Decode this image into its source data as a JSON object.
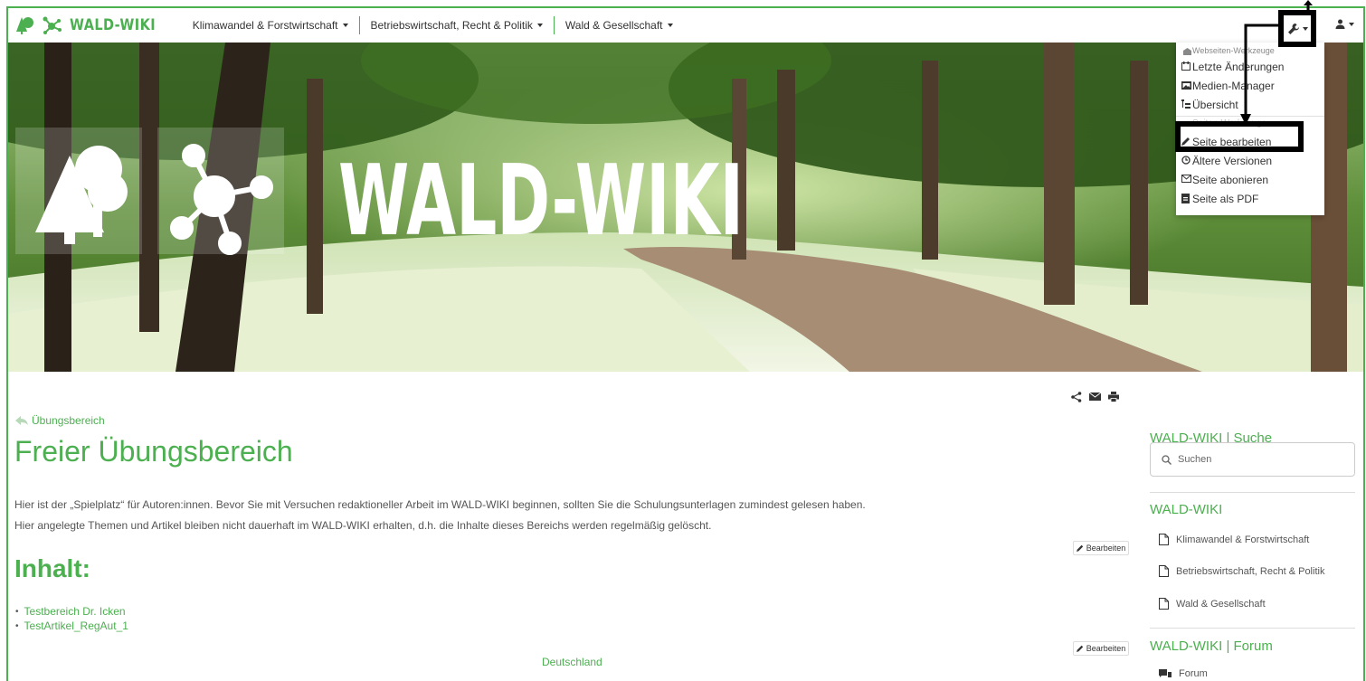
{
  "brand": {
    "name": "WALD-WIKI",
    "color": "#4caf50"
  },
  "nav": {
    "items": [
      {
        "label": "Klimawandel & Forstwirtschaft"
      },
      {
        "label": "Betriebswirtschaft, Recht & Politik"
      },
      {
        "label": "Wald & Gesellschaft"
      }
    ]
  },
  "toolbar": {
    "tools_icon": "wrench-icon",
    "user_icon": "user-icon"
  },
  "hero": {
    "title": "WALD-WIKI"
  },
  "tools_menu": {
    "header": "Webseiten-Werkzeuge",
    "site_items": [
      {
        "label": "Letzte Änderungen",
        "icon": "recent-changes-icon"
      },
      {
        "label": "Medien-Manager",
        "icon": "media-manager-icon"
      },
      {
        "label": "Übersicht",
        "icon": "sitemap-icon"
      }
    ],
    "page_header": "Seiten-Werkzeuge",
    "page_items": [
      {
        "label": "Seite bearbeiten",
        "icon": "pencil-icon"
      },
      {
        "label": "Ältere Versionen",
        "icon": "history-icon"
      },
      {
        "label": "Seite abonieren",
        "icon": "envelope-icon"
      },
      {
        "label": "Seite als PDF",
        "icon": "pdf-icon"
      }
    ]
  },
  "content": {
    "breadcrumb": "Übungsbereich",
    "title": "Freier Übungsbereich",
    "paragraphs": [
      "Hier ist der „Spielplatz“ für Autoren:innen. Bevor Sie mit Versuchen redaktioneller Arbeit im WALD-WIKI beginnen, sollten Sie die Schulungsunterlagen zumindest gelesen haben.",
      "Hier angelegte Themen und Artikel bleiben nicht dauerhaft im WALD-WIKI erhalten, d.h. die Inhalte dieses Bereichs werden regelmäßig gelöscht."
    ],
    "edit_label": "Bearbeiten",
    "section_title": "Inhalt:",
    "links": [
      "Testbereich Dr. Icken",
      "TestArtikel_RegAut_1"
    ],
    "footer_link": "Deutschland"
  },
  "sidebar": {
    "search_title": "WALD-WIKI | Suche",
    "search_placeholder": "Suchen",
    "nav_title": "WALD-WIKI",
    "nav_links": [
      "Klimawandel & Forstwirtschaft",
      "Betriebswirtschaft, Recht & Politik",
      "Wald & Gesellschaft"
    ],
    "forum_title": "WALD-WIKI | Forum",
    "forum_link": "Forum"
  }
}
